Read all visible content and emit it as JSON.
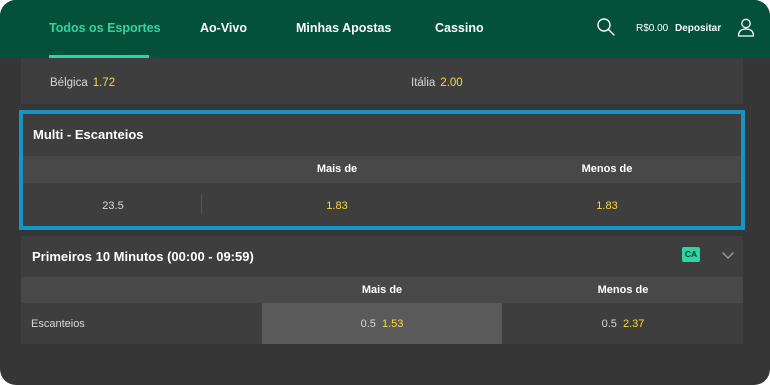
{
  "nav": {
    "tabs": [
      {
        "label": "Todos os Esportes"
      },
      {
        "label": "Ao-Vivo"
      },
      {
        "label": "Minhas Apostas"
      },
      {
        "label": "Cassino"
      }
    ],
    "balance": "R$0.00",
    "deposit_label": "Depositar"
  },
  "match": {
    "home": {
      "team": "Bélgica",
      "odd": "1.72"
    },
    "away": {
      "team": "Itália",
      "odd": "2.00"
    }
  },
  "multi_corners": {
    "title": "Multi - Escanteios",
    "col_over": "Mais de",
    "col_under": "Menos de",
    "line": "23.5",
    "over_odd": "1.83",
    "under_odd": "1.83"
  },
  "first_10": {
    "title": "Primeiros 10 Minutos (00:00 - 09:59)",
    "badge": "CA",
    "col_over": "Mais de",
    "col_under": "Menos de",
    "row_label": "Escanteios",
    "over_line": "0.5",
    "over_odd": "1.53",
    "under_line": "0.5",
    "under_odd": "2.37"
  },
  "colors": {
    "header_bg": "#035139",
    "accent": "#32d4a4",
    "odd": "#ffd836",
    "highlight": "#1595c6"
  },
  "icons": [
    "search-icon",
    "user-icon",
    "chevron-down-icon"
  ]
}
